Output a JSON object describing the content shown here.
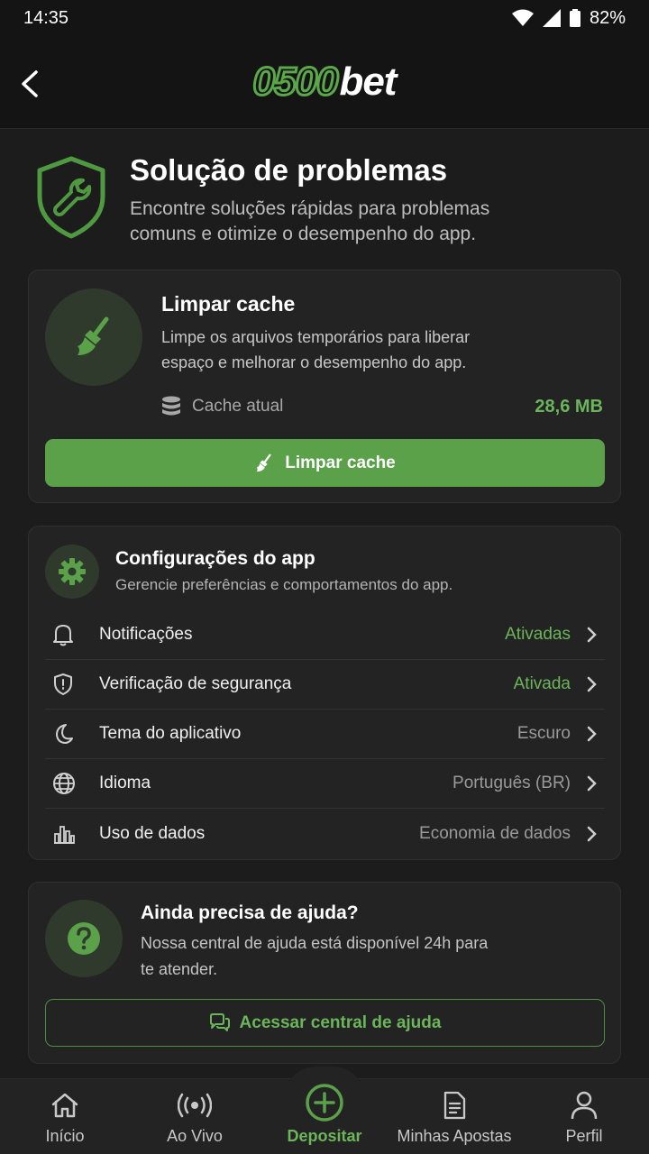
{
  "status_bar": {
    "time": "14:35",
    "battery": "82%"
  },
  "header": {
    "logo_number": "0500",
    "logo_word": "bet"
  },
  "hero": {
    "title": "Solução de problemas",
    "subtitle": "Encontre soluções rápidas para problemas comuns e otimize o desempenho do app."
  },
  "cache": {
    "title": "Limpar cache",
    "description": "Limpe os arquivos temporários para liberar espaço e melhorar o desempenho do app.",
    "current_label": "Cache atual",
    "current_size": "28,6 MB",
    "button_label": "Limpar cache"
  },
  "settings": {
    "title": "Configurações do app",
    "subtitle": "Gerencie preferências e comportamentos do app.",
    "items": [
      {
        "label": "Notificações",
        "value": "Ativadas",
        "icon": "bell-icon",
        "accent": true
      },
      {
        "label": "Verificação de segurança",
        "value": "Ativada",
        "icon": "shield-check-icon",
        "accent": true
      },
      {
        "label": "Tema do aplicativo",
        "value": "Escuro",
        "icon": "moon-icon",
        "accent": false
      },
      {
        "label": "Idioma",
        "value": "Português (BR)",
        "icon": "globe-icon",
        "accent": false
      },
      {
        "label": "Uso de dados",
        "value": "Economia de dados",
        "icon": "bar-chart-icon",
        "accent": false
      }
    ]
  },
  "help": {
    "title": "Ainda precisa de ajuda?",
    "description": "Nossa central de ajuda está disponível 24h para te atender.",
    "button_label": "Acessar central de ajuda"
  },
  "bottom_nav": {
    "items": [
      {
        "label": "Início",
        "icon": "home-icon"
      },
      {
        "label": "Ao Vivo",
        "icon": "live-broadcast-icon"
      },
      {
        "label": "Depositar",
        "icon": "plus-circle-icon",
        "active": true
      },
      {
        "label": "Minhas Apostas",
        "icon": "document-icon"
      },
      {
        "label": "Perfil",
        "icon": "user-icon"
      }
    ]
  },
  "colors": {
    "accent": "#5aa14a",
    "accent_text": "#6bb55a",
    "background": "#1c1c1c",
    "card": "#232323"
  }
}
